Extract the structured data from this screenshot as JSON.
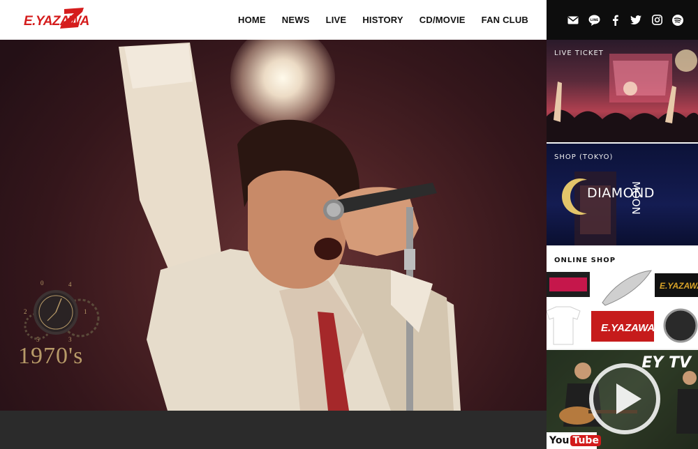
{
  "brand": {
    "logo_text": "E.YAZAWA",
    "accent": "#d51d1d"
  },
  "nav": {
    "items": [
      {
        "label": "HOME"
      },
      {
        "label": "NEWS"
      },
      {
        "label": "LIVE"
      },
      {
        "label": "HISTORY"
      },
      {
        "label": "CD/MOVIE"
      },
      {
        "label": "FAN CLUB"
      }
    ]
  },
  "social": {
    "icons": [
      "mail-icon",
      "line-icon",
      "facebook-icon",
      "twitter-icon",
      "instagram-icon",
      "spotify-icon"
    ],
    "line_text": "LINE"
  },
  "hero": {
    "decade": "1970's",
    "clock_digits": [
      "0",
      "4",
      "2",
      "1",
      "5",
      "3"
    ]
  },
  "sidebar": {
    "live_ticket": {
      "label": "LIVE TICKET"
    },
    "shop_tokyo": {
      "label": "SHOP (TOKYO)",
      "title_main": "DIAMOND",
      "title_vertical": "MOON"
    },
    "online_shop": {
      "label": "ONLINE SHOP",
      "towel_text": "E.YAZAWA"
    },
    "ey_tv": {
      "title": "EY TV",
      "youtube_you": "You",
      "youtube_tube": "Tube"
    }
  },
  "colors": {
    "header_bg": "#ffffff",
    "social_bg": "#0d0d0d",
    "gold": "#b79a68"
  }
}
